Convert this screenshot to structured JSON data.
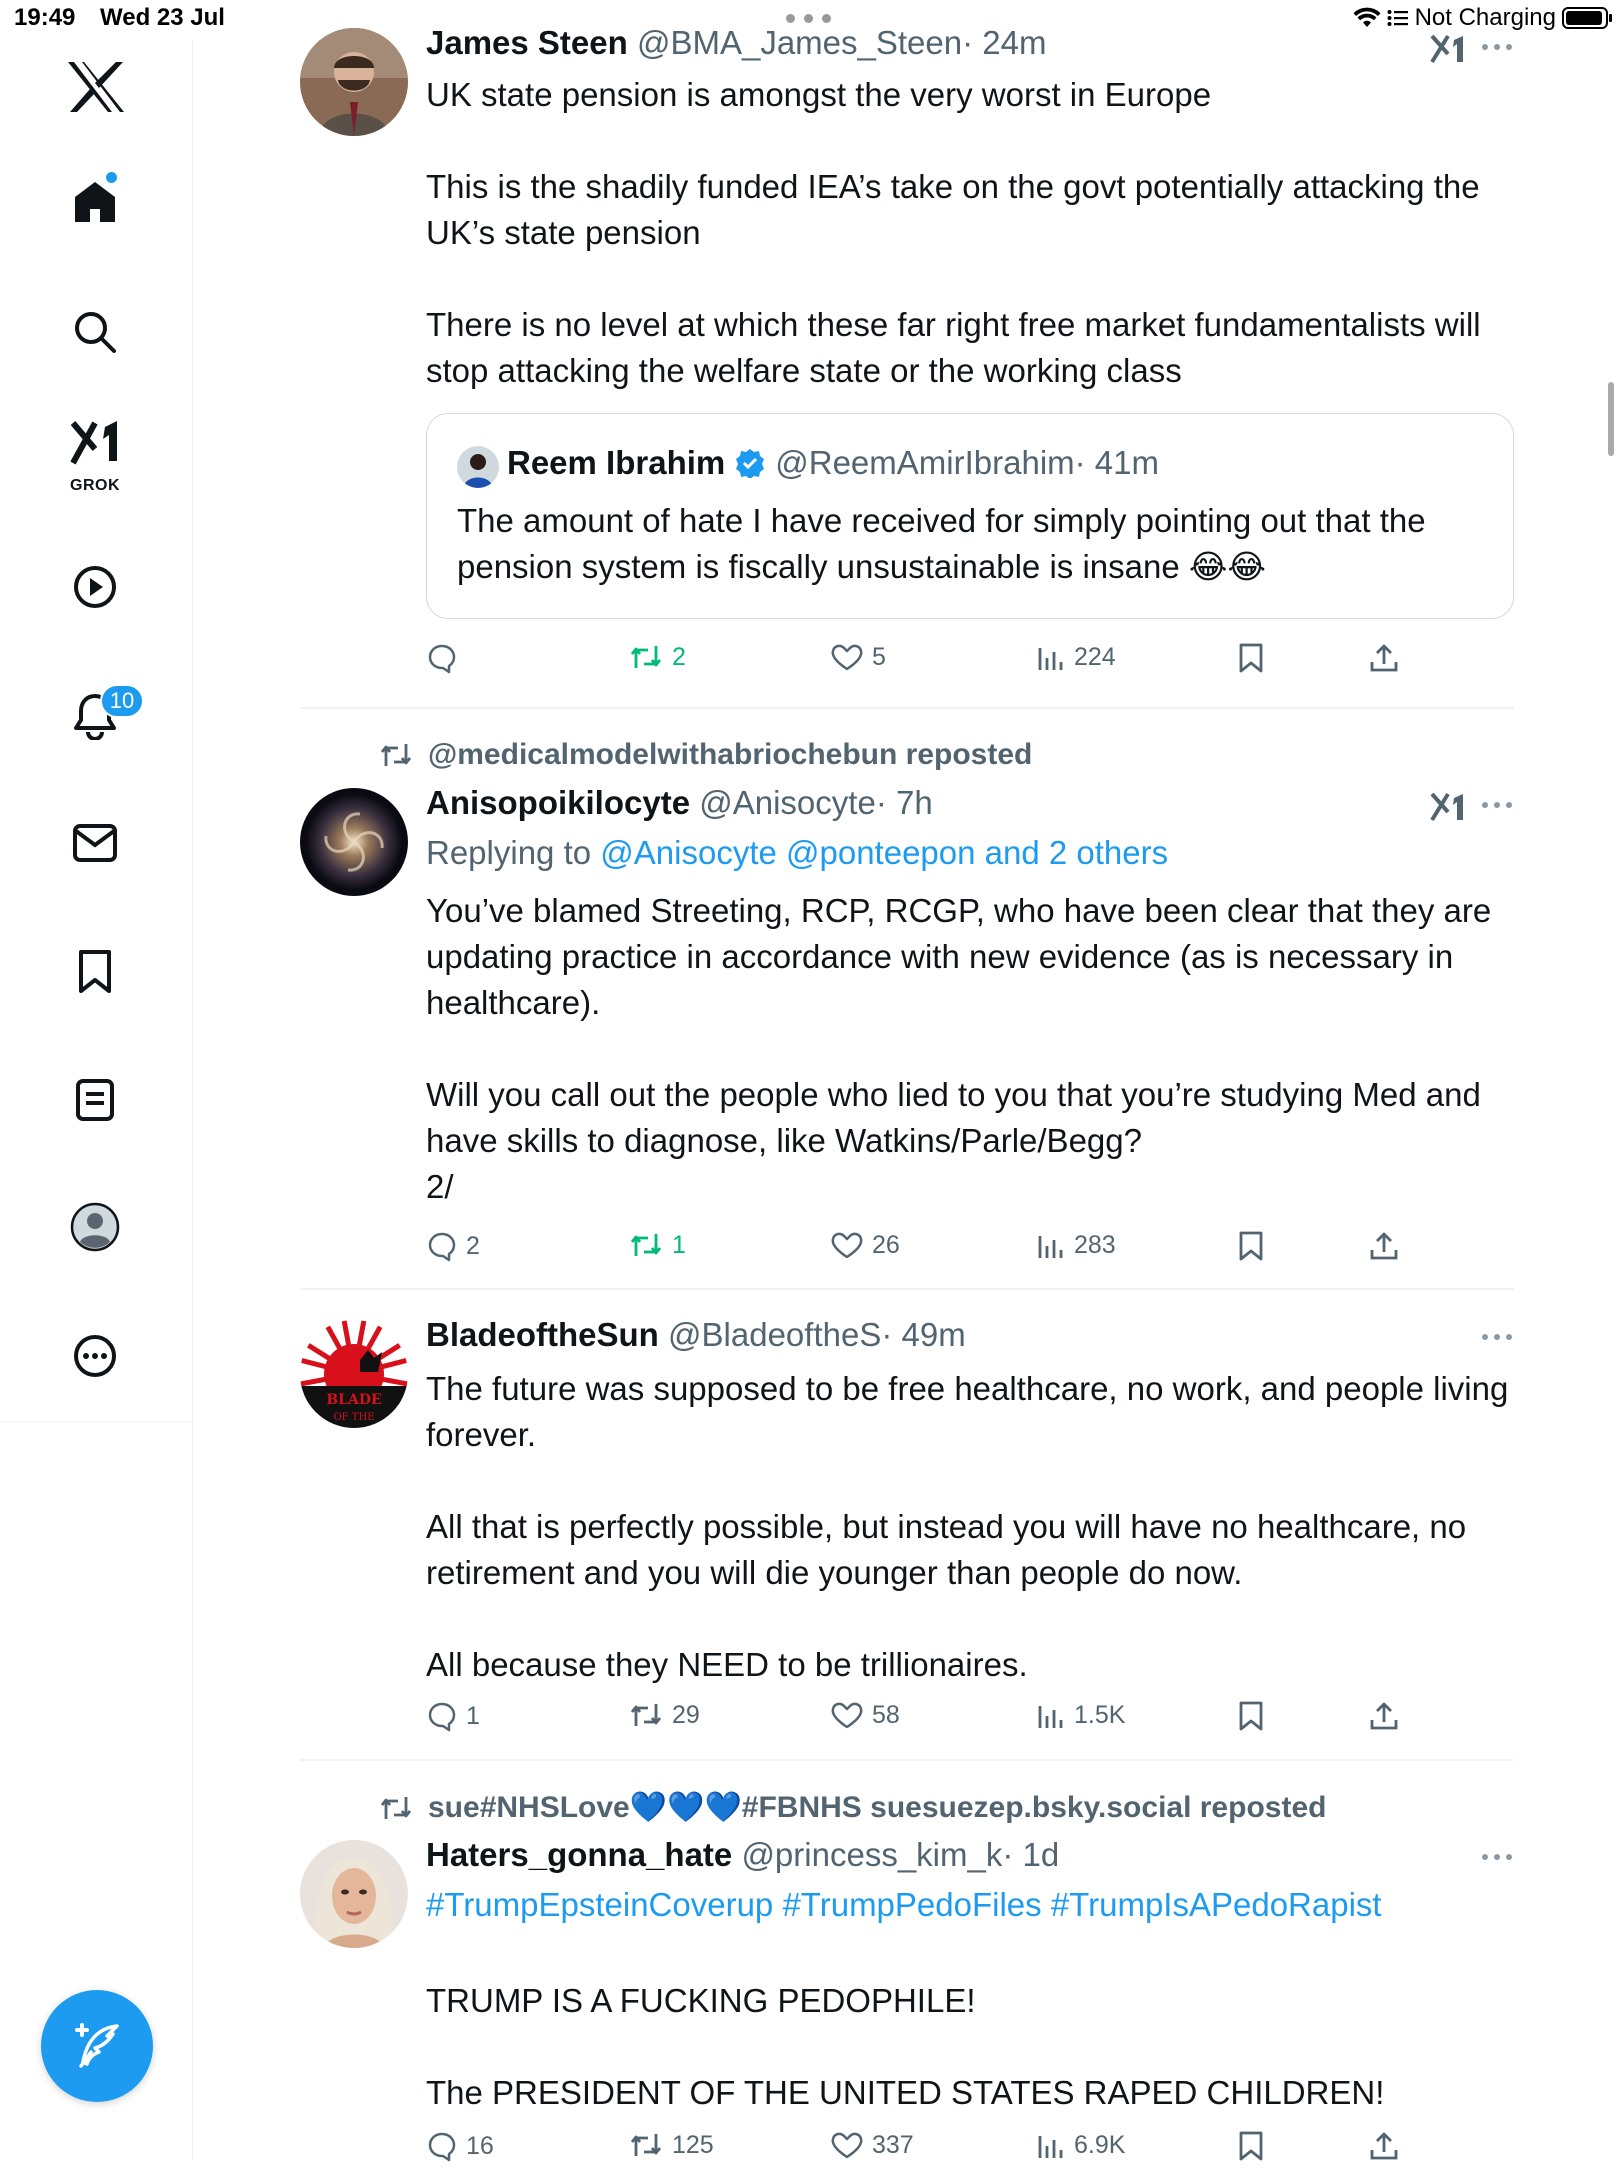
{
  "status_bar": {
    "time": "19:49",
    "date": "Wed 23 Jul",
    "charging": "Not Charging",
    "battery_level": 0.95
  },
  "sidebar": {
    "notifications_badge": "10",
    "grok_label": "GROK",
    "items": [
      "x-logo",
      "home",
      "search",
      "grok",
      "video",
      "notifications",
      "messages",
      "bookmarks",
      "lists",
      "profile",
      "more"
    ]
  },
  "colors": {
    "accent": "#1d9bf0",
    "retweet_green": "#00ba7c",
    "secondary_text": "#536471",
    "primary_text": "#0f1419"
  },
  "tweets": [
    {
      "name": "James Steen",
      "handle": "@BMA_James_Steen",
      "time": "· 24m",
      "text": "UK state pension is amongst the very worst in Europe\n\nThis is the shadily funded IEA’s take on the govt potentially attacking the UK’s state pension\n\nThere is no level at which these far right free market fundamentalists will stop attacking the welfare state or the working class",
      "quote": {
        "name": "Reem Ibrahim",
        "handle": "@ReemAmirIbrahim",
        "time": "· 41m",
        "text": "The amount of hate I have received for simply pointing out that the pension system is fiscally unsustainable is insane 😂😂"
      },
      "replies": "",
      "retweets": "2",
      "likes": "5",
      "views": "224"
    },
    {
      "reposted_by": "@medicalmodelwithabriochebun reposted",
      "name": "Anisopoikilocyte",
      "handle": "@Anisocyte",
      "time": "· 7h",
      "replying_prefix": "Replying to ",
      "replying_to": "@Anisocyte @ponteepon and 2 others",
      "text": "You’ve blamed Streeting, RCP, RCGP, who have been clear that they are updating practice in accordance with new evidence (as is necessary in healthcare).\n\nWill you call out the people who lied to you that you’re studying Med and have skills to diagnose, like Watkins/Parle/Begg?\n2/",
      "replies": "2",
      "retweets": "1",
      "likes": "26",
      "views": "283"
    },
    {
      "name": "BladeoftheSun",
      "handle": "@BladeoftheS",
      "time": "· 49m",
      "avatar_text_1": "BLADE",
      "avatar_text_2": "OF THE",
      "text": "The future was supposed to be free healthcare, no work, and people living forever.\n\nAll that is perfectly possible, but instead you will have no healthcare, no retirement and you will die younger than people do now.\n\nAll because they NEED to be trillionaires.",
      "replies": "1",
      "retweets": "29",
      "likes": "58",
      "views": "1.5K"
    },
    {
      "reposted_by": "sue#NHSLove💙💙💙#FBNHS suesuezep.bsky.social reposted",
      "name": "Haters_gonna_hate",
      "handle": "@princess_kim_k",
      "time": "· 1d",
      "hashtags": "#TrumpEpsteinCoverup #TrumpPedoFiles #TrumpIsAPedoRapist",
      "text": "TRUMP IS A FUCKING PEDOPHILE!\n\nThe PRESIDENT OF THE UNITED STATES RAPED CHILDREN!",
      "replies": "16",
      "retweets": "125",
      "likes": "337",
      "views": "6.9K"
    }
  ]
}
